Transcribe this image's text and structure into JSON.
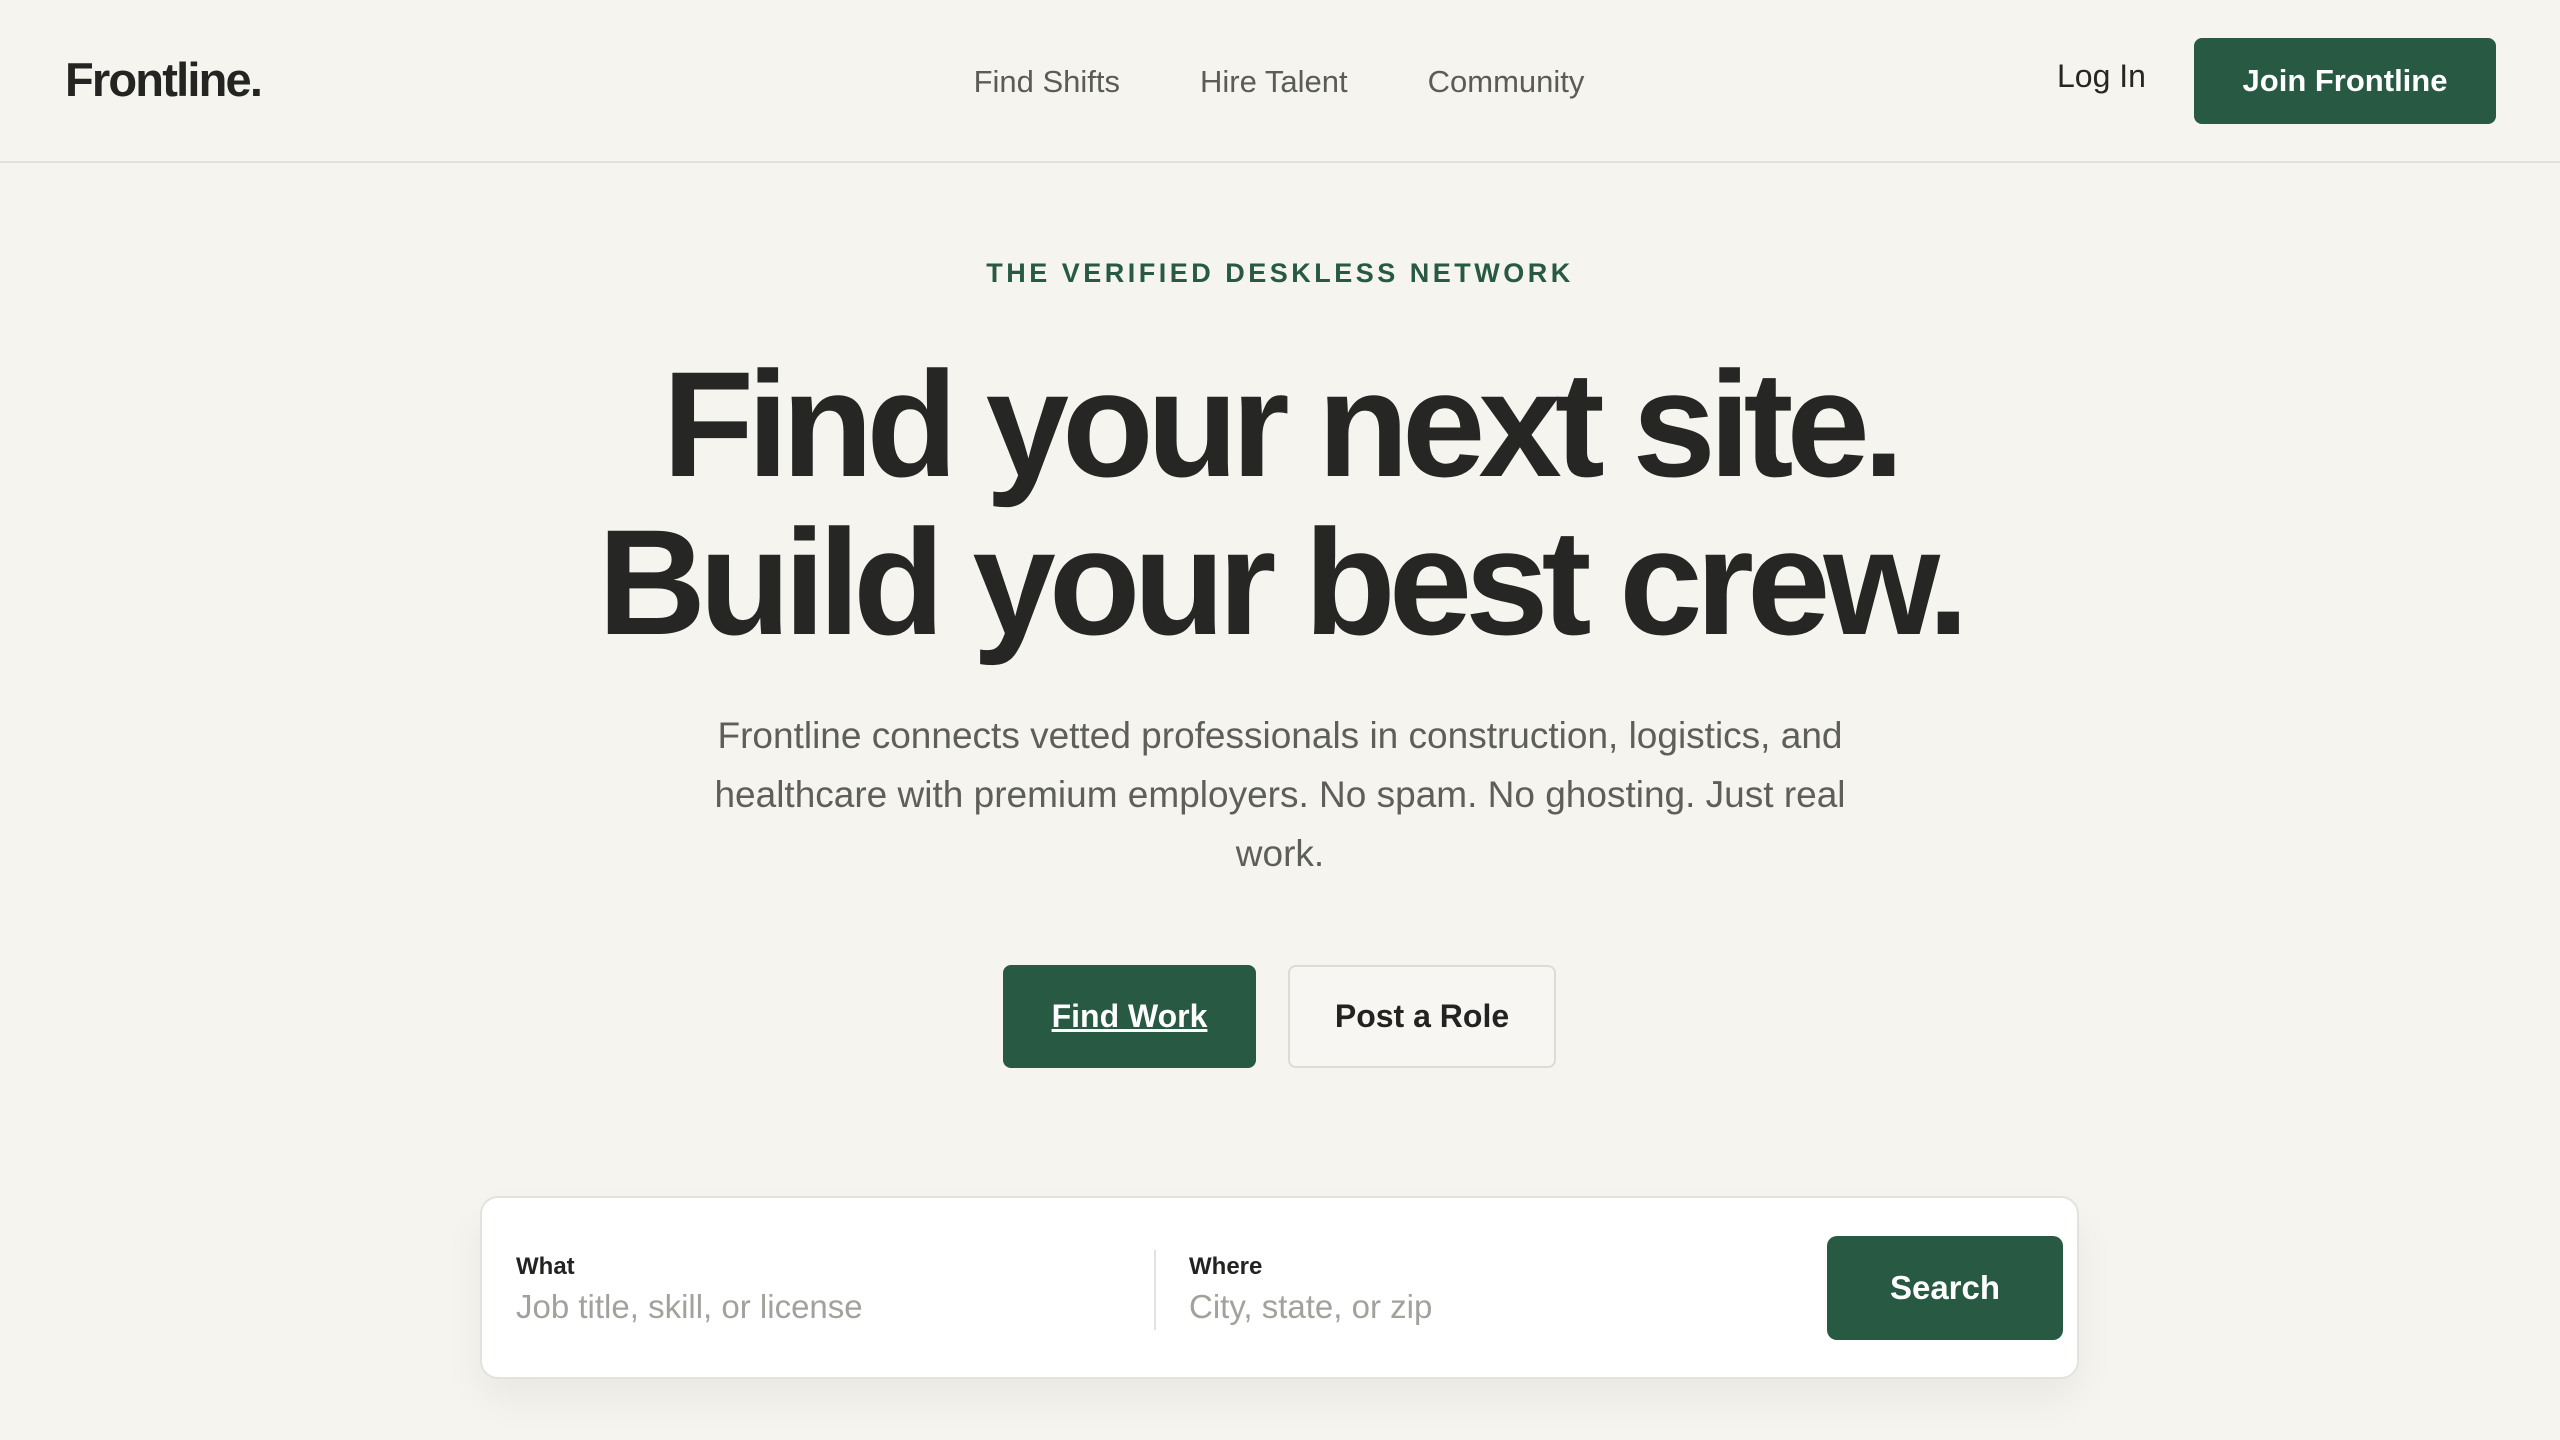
{
  "header": {
    "logo": "Frontline.",
    "nav": [
      "Find Shifts",
      "Hire Talent",
      "Community"
    ],
    "login_label": "Log In",
    "join_label": "Join Frontline"
  },
  "hero": {
    "eyebrow": "THE VERIFIED DESKLESS NETWORK",
    "headline_line1": "Find your next site.",
    "headline_line2": "Build your best crew.",
    "subtitle": "Frontline connects vetted professionals in construction, logistics, and healthcare with premium employers. No spam. No ghosting. Just real work.",
    "primary_cta": "Find Work",
    "secondary_cta": "Post a Role"
  },
  "search": {
    "what_label": "What",
    "what_placeholder": "Job title, skill, or license",
    "where_label": "Where",
    "where_placeholder": "City, state, or zip",
    "button_label": "Search"
  },
  "colors": {
    "background": "#f5f4ef",
    "brand_green": "#275943",
    "text_dark": "#262625",
    "text_muted": "#5e5e5a"
  }
}
